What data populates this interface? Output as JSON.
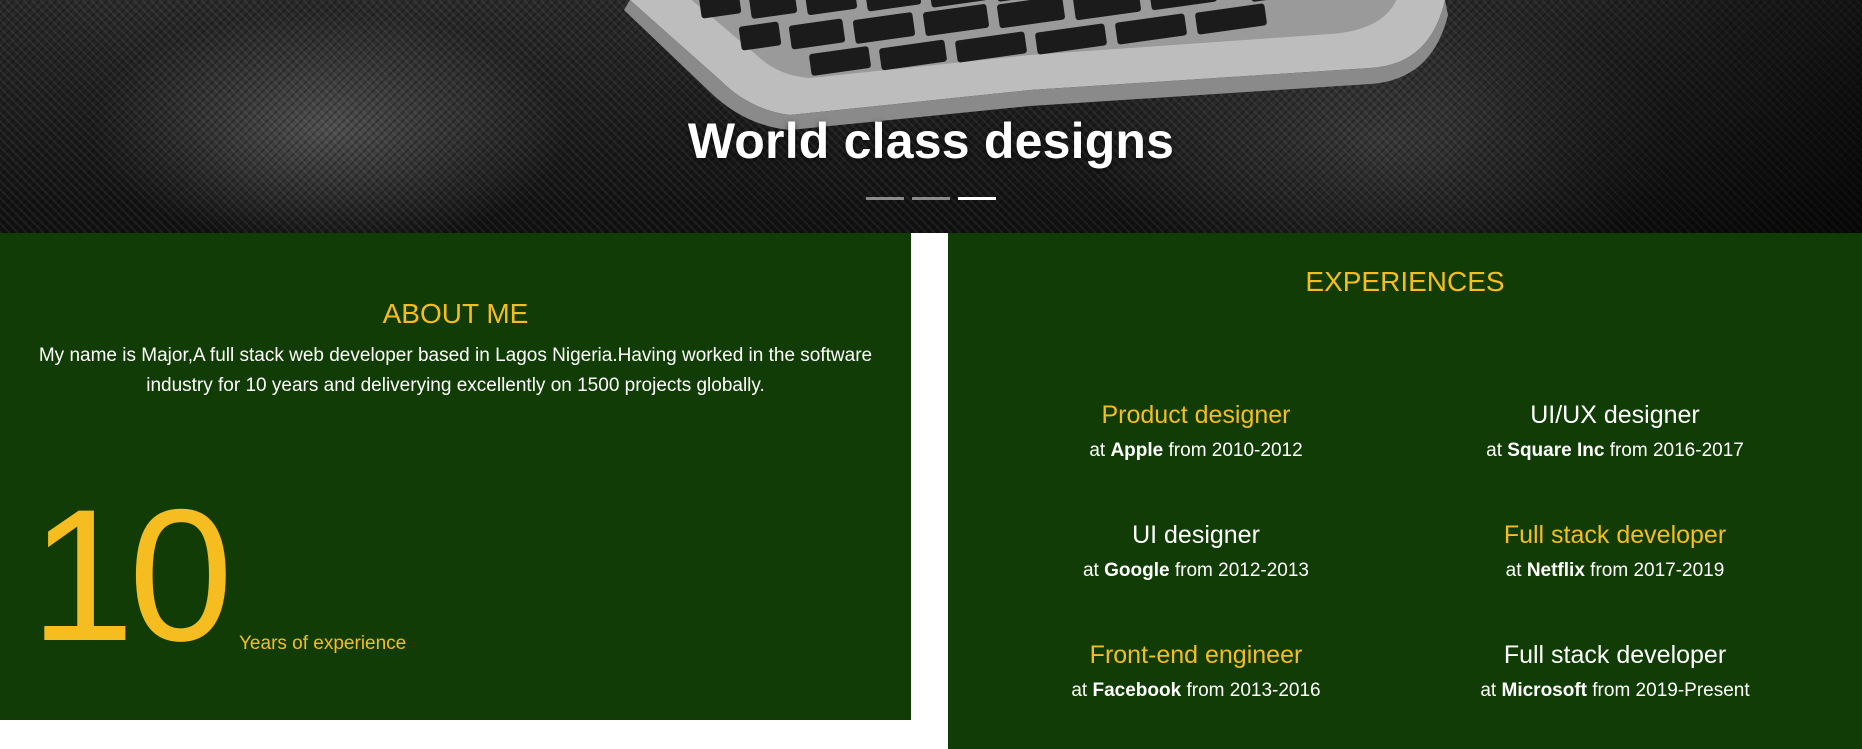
{
  "hero": {
    "title": "World class designs",
    "slides": [
      {
        "active": false
      },
      {
        "active": false
      },
      {
        "active": true
      }
    ]
  },
  "about": {
    "title": "ABOUT ME",
    "text": "My name is Major,A full stack web developer based in Lagos Nigeria.Having worked in the software industry for 10 years and deliverying excellently on 1500 projects globally.",
    "years_number": "10",
    "years_label": "Years of experience"
  },
  "experiences": {
    "title": "EXPERIENCES",
    "items": [
      {
        "role": "Product designer",
        "at": "at",
        "company": "Apple",
        "period": "from 2010-2012",
        "color": "#f5bd1f"
      },
      {
        "role": "UI/UX designer",
        "at": "at",
        "company": "Square Inc",
        "period": "from 2016-2017",
        "color": "#ffffff"
      },
      {
        "role": "UI designer",
        "at": "at",
        "company": "Google",
        "period": "from 2012-2013",
        "color": "#ffffff"
      },
      {
        "role": "Full stack developer",
        "at": "at",
        "company": "Netflix",
        "period": "from 2017-2019",
        "color": "#f5bd1f"
      },
      {
        "role": "Front-end engineer",
        "at": "at",
        "company": "Facebook",
        "period": "from 2013-2016",
        "color": "#f5bd1f"
      },
      {
        "role": "Full stack developer",
        "at": "at",
        "company": "Microsoft",
        "period": "from 2019-Present",
        "color": "#ffffff"
      }
    ]
  },
  "colors": {
    "panel_bg": "#113c06",
    "accent_gold": "#f5bd1f",
    "text_white": "#ffffff"
  }
}
